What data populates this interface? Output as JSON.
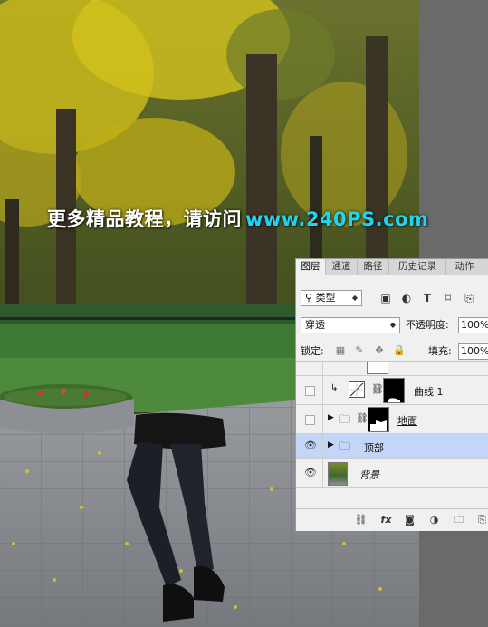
{
  "watermark": {
    "text_cn": "更多精品教程，请访问",
    "url": "www.240PS.com"
  },
  "panel": {
    "tabs": [
      "图层",
      "通道",
      "路径",
      "历史记录",
      "动作"
    ],
    "active_tab": "图层",
    "filter": {
      "label": "类型",
      "icons": [
        "image-filter-icon",
        "adjustment-filter-icon",
        "type-filter-icon",
        "shape-filter-icon",
        "smart-object-filter-icon"
      ]
    },
    "blend_mode": "穿透",
    "opacity_label": "不透明度:",
    "opacity_value": "100%",
    "lock_label": "锁定:",
    "fill_label": "填充:",
    "fill_value": "100%",
    "layers": [
      {
        "name": "",
        "visible": false,
        "kind": "partial"
      },
      {
        "name": "曲线 1",
        "visible": false,
        "kind": "curves"
      },
      {
        "name": "地面",
        "visible": false,
        "kind": "group-masked"
      },
      {
        "name": "顶部",
        "visible": true,
        "kind": "group",
        "selected": true
      },
      {
        "name": "背景",
        "visible": true,
        "kind": "background"
      }
    ],
    "bottom_icons": [
      "link-icon",
      "fx-icon",
      "mask-icon",
      "adjustment-icon",
      "folder-icon",
      "new-layer-icon"
    ]
  },
  "colors": {
    "accent_url": "#1fd4ef",
    "selected_row": "#c4d6f7"
  }
}
